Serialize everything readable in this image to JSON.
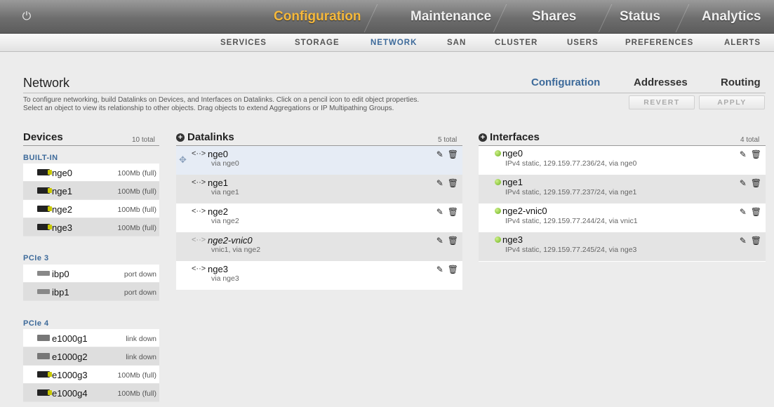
{
  "topnav": {
    "tabs": [
      "Configuration",
      "Maintenance",
      "Shares",
      "Status",
      "Analytics"
    ],
    "active": "Configuration"
  },
  "subnav": {
    "tabs": [
      "SERVICES",
      "STORAGE",
      "NETWORK",
      "SAN",
      "CLUSTER",
      "USERS",
      "PREFERENCES",
      "ALERTS"
    ],
    "active": "NETWORK"
  },
  "page": {
    "title": "Network",
    "view_tabs": [
      "Configuration",
      "Addresses",
      "Routing"
    ],
    "active_view": "Configuration",
    "description_line1": "To configure networking, build Datalinks on Devices, and Interfaces on Datalinks. Click on a pencil icon to edit object properties.",
    "description_line2": "Select an object to view its relationship to other objects. Drag objects to extend Aggregations or IP Multipathing Groups.",
    "revert_label": "REVERT",
    "apply_label": "APPLY"
  },
  "devices": {
    "title": "Devices",
    "total": "10 total",
    "groups": [
      {
        "label": "BUILT-IN",
        "items": [
          {
            "name": "nge0",
            "status": "100Mb (full)",
            "icon": "nic-active-icon"
          },
          {
            "name": "nge1",
            "status": "100Mb (full)",
            "icon": "nic-active-icon"
          },
          {
            "name": "nge2",
            "status": "100Mb (full)",
            "icon": "nic-active-icon"
          },
          {
            "name": "nge3",
            "status": "100Mb (full)",
            "icon": "nic-active-icon"
          }
        ]
      },
      {
        "label": "PCIe 3",
        "items": [
          {
            "name": "ibp0",
            "status": "port down",
            "icon": "ib-port-icon"
          },
          {
            "name": "ibp1",
            "status": "port down",
            "icon": "ib-port-icon"
          }
        ]
      },
      {
        "label": "PCIe 4",
        "items": [
          {
            "name": "e1000g1",
            "status": "link down",
            "icon": "nic-down-icon"
          },
          {
            "name": "e1000g2",
            "status": "link down",
            "icon": "nic-down-icon"
          },
          {
            "name": "e1000g3",
            "status": "100Mb (full)",
            "icon": "nic-active-icon"
          },
          {
            "name": "e1000g4",
            "status": "100Mb (full)",
            "icon": "nic-active-icon"
          }
        ]
      }
    ]
  },
  "datalinks": {
    "title": "Datalinks",
    "total": "5 total",
    "items": [
      {
        "name": "nge0",
        "sub": "via nge0"
      },
      {
        "name": "nge1",
        "sub": "via nge1"
      },
      {
        "name": "nge2",
        "sub": "via nge2"
      },
      {
        "name": "nge2-vnic0",
        "sub": "vnic1, via nge2"
      },
      {
        "name": "nge3",
        "sub": "via nge3"
      }
    ]
  },
  "interfaces": {
    "title": "Interfaces",
    "total": "4 total",
    "items": [
      {
        "name": "nge0",
        "sub": "IPv4 static, 129.159.77.236/24, via nge0"
      },
      {
        "name": "nge1",
        "sub": "IPv4 static, 129.159.77.237/24, via nge1"
      },
      {
        "name": "nge2-vnic0",
        "sub": "IPv4 static, 129.159.77.244/24, via vnic1"
      },
      {
        "name": "nge3",
        "sub": "IPv4 static, 129.159.77.245/24, via nge3"
      }
    ]
  },
  "colors": {
    "accent": "#3d6a9a",
    "active_top_tab": "#f6b93b",
    "link_up": "#6cb21e"
  }
}
